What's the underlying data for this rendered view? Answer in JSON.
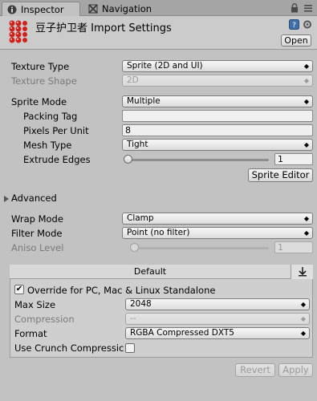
{
  "tabs": [
    {
      "label": "Inspector",
      "active": true
    },
    {
      "label": "Navigation",
      "active": false
    }
  ],
  "header": {
    "title": "豆子护卫者 Import Settings",
    "open_label": "Open"
  },
  "fields": {
    "texture_type": {
      "label": "Texture Type",
      "value": "Sprite (2D and UI)"
    },
    "texture_shape": {
      "label": "Texture Shape",
      "value": "2D"
    },
    "sprite_mode": {
      "label": "Sprite Mode",
      "value": "Multiple"
    },
    "packing_tag": {
      "label": "Packing Tag",
      "value": ""
    },
    "pixels_per_unit": {
      "label": "Pixels Per Unit",
      "value": "8"
    },
    "mesh_type": {
      "label": "Mesh Type",
      "value": "Tight"
    },
    "extrude_edges": {
      "label": "Extrude Edges",
      "value": "1"
    },
    "sprite_editor_label": "Sprite Editor",
    "advanced_label": "Advanced",
    "wrap_mode": {
      "label": "Wrap Mode",
      "value": "Clamp"
    },
    "filter_mode": {
      "label": "Filter Mode",
      "value": "Point (no filter)"
    },
    "aniso_level": {
      "label": "Aniso Level",
      "value": "1"
    }
  },
  "platform": {
    "tab_label": "Default",
    "override_label": "Override for PC, Mac & Linux Standalone",
    "override_checked": true,
    "max_size": {
      "label": "Max Size",
      "value": "2048"
    },
    "compression": {
      "label": "Compression",
      "value": "--"
    },
    "format": {
      "label": "Format",
      "value": "RGBA Compressed DXT5"
    },
    "crunch_label": "Use Crunch Compressic"
  },
  "footer": {
    "revert_label": "Revert",
    "apply_label": "Apply"
  }
}
